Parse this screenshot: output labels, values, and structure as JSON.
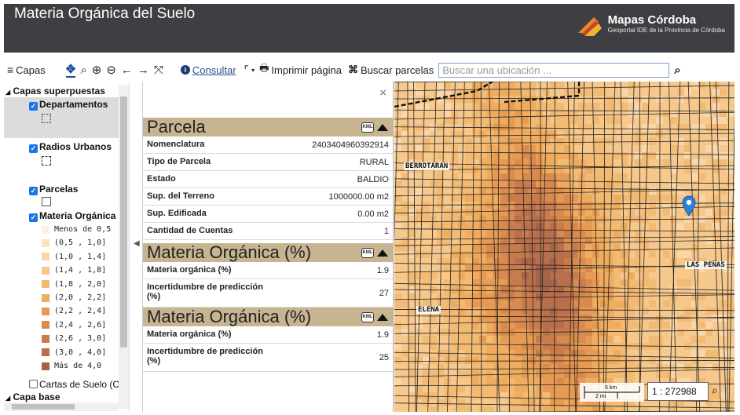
{
  "header": {
    "title": "Materia Orgánica del Suelo",
    "brand_name": "Mapas Córdoba",
    "brand_sub": "Geoportal IDE de la Provincia de Córdoba"
  },
  "toolbar": {
    "layers_label": "Capas",
    "consult_label": "Consultar",
    "print_label": "Imprimir página",
    "parcel_label": "Buscar parcelas",
    "search_placeholder": "Buscar una ubicación ..."
  },
  "layers": {
    "group_overlay": "Capas superpuestas",
    "items": [
      {
        "label": "Departamentos",
        "checked": true
      },
      {
        "label": "Radios Urbanos",
        "checked": true
      },
      {
        "label": "Parcelas",
        "checked": true
      },
      {
        "label": "Materia Orgánica",
        "checked": true
      },
      {
        "label": "Cartas de Suelo (C",
        "checked": false
      }
    ],
    "legend": [
      {
        "label": "Menos de 0,5",
        "color": "#fdf1dc"
      },
      {
        "label": "(0,5 , 1,0]",
        "color": "#fbe3c1"
      },
      {
        "label": "(1,0 , 1,4]",
        "color": "#f9d7a9"
      },
      {
        "label": "(1,4 , 1,8]",
        "color": "#f6c88c"
      },
      {
        "label": "(1,8 , 2,0]",
        "color": "#f3ba74"
      },
      {
        "label": "(2,0 , 2,2]",
        "color": "#efac5f"
      },
      {
        "label": "(2,2 , 2,4]",
        "color": "#e79a52"
      },
      {
        "label": "(2,4 , 2,6]",
        "color": "#d98a4e"
      },
      {
        "label": "(2,6 , 3,0]",
        "color": "#c87b4c"
      },
      {
        "label": "(3,0 , 4,0]",
        "color": "#b96f4c"
      },
      {
        "label": "Más de 4,0",
        "color": "#a4644a"
      }
    ],
    "group_base": "Capa base"
  },
  "info": {
    "close": "×",
    "parcela": {
      "title": "Parcela",
      "rows": [
        {
          "k": "Nomenclatura",
          "v": "2403404960392914"
        },
        {
          "k": "Tipo de Parcela",
          "v": "RURAL"
        },
        {
          "k": "Estado",
          "v": "BALDIO"
        },
        {
          "k": "Sup. del Terreno",
          "v": "1000000.00 m2"
        },
        {
          "k": "Sup. Edificada",
          "v": "0.00 m2"
        },
        {
          "k": "Cantidad de Cuentas",
          "v": "1"
        }
      ]
    },
    "mo1": {
      "title": "Materia Orgánica (%)",
      "rows": [
        {
          "k": "Materia orgánica (%)",
          "v": "1.9"
        },
        {
          "k": "Incertidumbre de predicción (%)",
          "v": "27"
        }
      ]
    },
    "mo2": {
      "title": "Materia Orgánica (%)",
      "rows": [
        {
          "k": "Materia orgánica (%)",
          "v": "1.9"
        },
        {
          "k": "Incertidumbre de predicción (%)",
          "v": "25"
        }
      ]
    },
    "kml": "KML"
  },
  "map": {
    "labels": {
      "berrotaran": "BERROTARAN",
      "elena": "ELENA",
      "las_penas": "LAS PEÑAS"
    },
    "scale_km": "5 km",
    "scale_mi": "2 mi",
    "scale_value": "1 : 272988"
  }
}
